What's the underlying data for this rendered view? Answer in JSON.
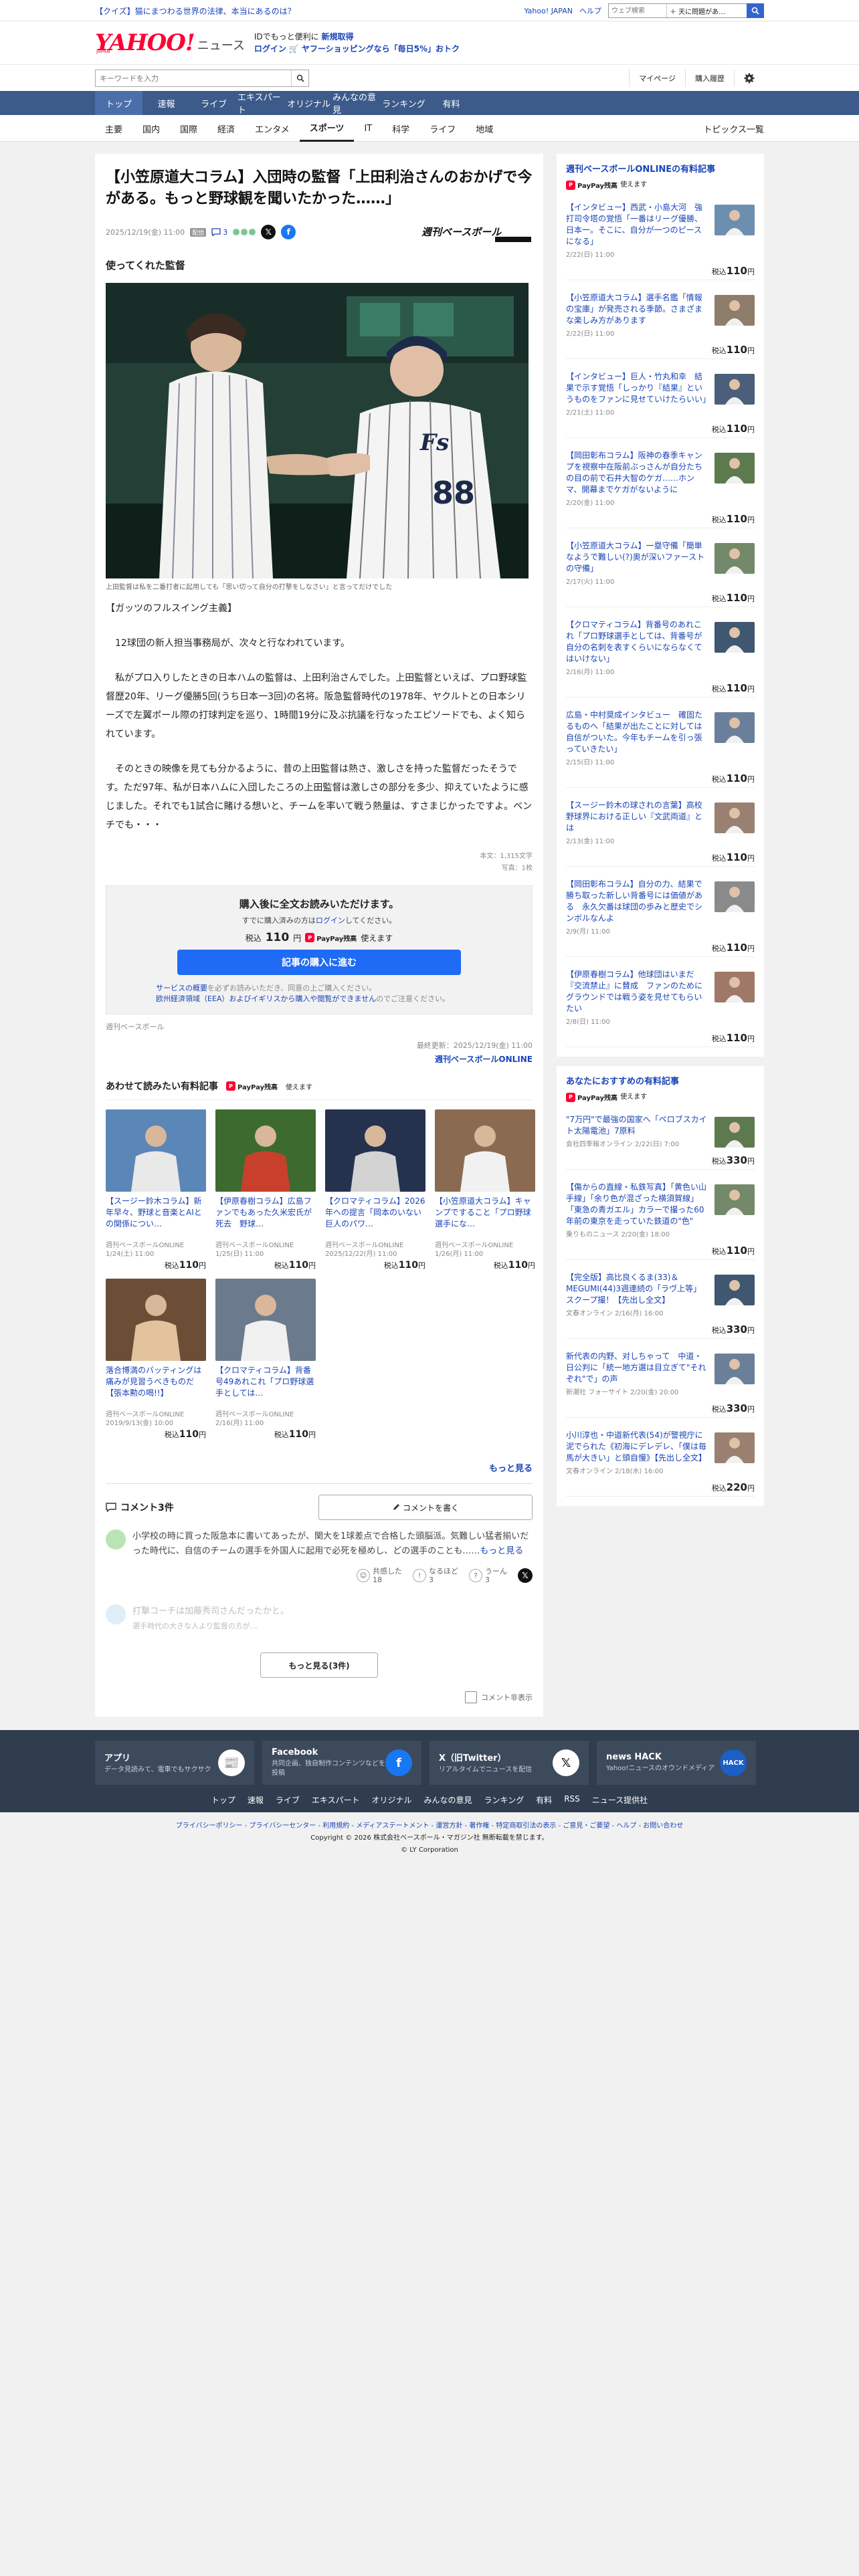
{
  "topbar": {
    "quiz": "【クイズ】猫にまつわる世界の法律、本当にあるのは？",
    "links": [
      "Yahoo! JAPAN",
      "ヘルプ"
    ],
    "search_placeholder": "ウェブ検索",
    "search_scope": "＋ 天に問題があ…"
  },
  "header": {
    "logo": "YAHOO!",
    "logo_sub": "JAPAN",
    "logo_news": "ニュース",
    "promo_line1_a": "IDでもっと便利に",
    "promo_line1_b": "新規取得",
    "promo_login": "ログイン",
    "promo_line2": "🛒 ヤフーショッピングなら「毎日5%」おトク"
  },
  "search": {
    "placeholder": "キーワードを入力",
    "mypage": "マイページ",
    "history": "購入履歴"
  },
  "gnav": [
    "トップ",
    "速報",
    "ライブ",
    "エキスパート",
    "オリジナル",
    "みんなの意見",
    "ランキング",
    "有料"
  ],
  "snav": [
    "主要",
    "国内",
    "国際",
    "経済",
    "エンタメ",
    "スポーツ",
    "IT",
    "科学",
    "ライフ",
    "地域"
  ],
  "snav_right": "トピックス一覧",
  "article": {
    "title": "【小笠原道大コラム】入団時の監督「上田利治さんのおかげで今がある。もっと野球観を聞いたかった……」",
    "date": "2025/12/19(金) 11:00",
    "badge": "配信",
    "comment_count": "3",
    "publisher_logo": "週刊ベースボール",
    "section": "使ってくれた監督",
    "caption": "上田監督は私を二番打者に起用しても「思い切って自分の打撃をしなさい」と言ってだけでした",
    "p1": "【ガッツのフルスイング主義】",
    "p2": "　12球団の新人担当事務局が、次々と行なわれています。",
    "p3": "　私がプロ入りしたときの日本ハムの監督は、上田利治さんでした。上田監督といえば、プロ野球監督歴20年、リーグ優勝5回(うち日本一3回)の名将。阪急監督時代の1978年、ヤクルトとの日本シリーズで左翼ポール際の打球判定を巡り、1時間19分に及ぶ抗議を行なったエピソードでも、よく知られています。",
    "p4": "　そのときの映像を見ても分かるように、昔の上田監督は熱さ、激しさを持った監督だったそうです。ただ97年、私が日本ハムに入団したころの上田監督は激しさの部分を多少、抑えていたように感じました。それでも1試合に賭ける想いと、チームを率いて戦う熱量は、すさまじかったですよ。ベンチでも・・・",
    "count1": "本文：1,315文字",
    "count2": "写真：1枚",
    "pay_heading": "購入後に全文お読みいただけます。",
    "pay_sub_a": "すでに購入済みの方は",
    "pay_sub_link": "ログイン",
    "pay_sub_b": "してください。",
    "price_label": "税込",
    "price": "110",
    "price_unit": "円",
    "paypay": "PayPay残高",
    "paypay_suffix": "使えます",
    "buy": "記事の購入に進む",
    "note1_link": "サービスの概要",
    "note1": "を必ずお読みいただき、同意の上ご購入ください。",
    "note2_link": "欧州経済領域（EEA）およびイギリスから購入や閲覧ができません",
    "note2": "のでご注意ください。",
    "publisher": "週刊ベースボール",
    "updated": "最終更新：2025/12/19(金) 11:00",
    "publisher_online": "週刊ベースボールONLINE"
  },
  "related": {
    "heading": "あわせて読みたい有料記事",
    "items": [
      {
        "title": "【スージー鈴木コラム】新年早々、野球と音楽とAIとの関係につい…",
        "source": "週刊ベースボールONLINE",
        "date": "1/24(土) 11:00",
        "price": "110"
      },
      {
        "title": "【伊原春樹コラム】広島ファンでもあった久米宏氏が死去　野球…",
        "source": "週刊ベースボールONLINE",
        "date": "1/25(日) 11:00",
        "price": "110"
      },
      {
        "title": "【クロマティコラム】2026年への提言「岡本のいない巨人のパワ…",
        "source": "週刊ベースボールONLINE",
        "date": "2025/12/22(月) 11:00",
        "price": "110"
      },
      {
        "title": "【小笠原道大コラム】キャンプですること「プロ野球選手にな…",
        "source": "週刊ベースボールONLINE",
        "date": "1/26(月) 11:00",
        "price": "110"
      },
      {
        "title": "落合博満のバッティングは痛みが見習うべきものだ【張本勲の喝!!】",
        "source": "週刊ベースボールONLINE",
        "date": "2019/9/13(金) 10:00",
        "price": "110"
      },
      {
        "title": "【クロマティコラム】背番号49あれこれ「プロ野球選手としては…",
        "source": "週刊ベースボールONLINE",
        "date": "2/16(月) 11:00",
        "price": "110"
      }
    ],
    "more": "もっと見る"
  },
  "comments": {
    "heading": "コメント3件",
    "write": "コメントを書く",
    "first": "小学校の時に買った阪急本に書いてあったが、関大を1球差点で合格した頭脳派。気難しい猛者揃いだった時代に、自信のチームの選手を外国人に起用で必死を極めし、どの選手のことも……",
    "first_more": "もっと見る",
    "r1_label": "共感した",
    "r1": "18",
    "r2_label": "なるほど",
    "r2": "3",
    "r3_label": "うーん",
    "r3": "3",
    "second": "打撃コーチは加藤秀司さんだったかと。",
    "second_b": "選手時代の大きな人より監督の方が…",
    "more": "もっと見る(3件)",
    "hide": "コメント非表示"
  },
  "sidebar": {
    "heading1": "週刊ベースボールONLINEの有料記事",
    "items1": [
      {
        "title": "【インタビュー】西武・小島大河　強打司令塔の覚悟「一番はリーグ優勝、日本一。そこに、自分が一つのピースになる」",
        "date": "2/22(日) 11:00",
        "price": "110"
      },
      {
        "title": "【小笠原道大コラム】選手名鑑「情報の宝庫」が発売される季節。さまざまな楽しみ方があります",
        "date": "2/22(日) 11:00",
        "price": "110"
      },
      {
        "title": "【インタビュー】巨人・竹丸和幸　結果で示す覚悟「しっかり『結果』というものをファンに見せていけたらいい」",
        "date": "2/21(土) 11:00",
        "price": "110"
      },
      {
        "title": "【岡田彰布コラム】阪神の春季キャンプを視察中在阪前ぶっさんが自分たちの目の前で石井大智のケガ……ホンマ、開幕までケガがないように",
        "date": "2/20(金) 11:00",
        "price": "110"
      },
      {
        "title": "【小笠原道大コラム】一塁守備「簡単なようで難しい(?)奥が深いファーストの守備」",
        "date": "2/17(火) 11:00",
        "price": "110"
      },
      {
        "title": "【クロマティコラム】背番号のあれこれ「プロ野球選手としては、背番号が自分の名刺を表すくらいにならなくてはいけない」",
        "date": "2/16(月) 11:00",
        "price": "110"
      },
      {
        "title": "広島・中村奨成インタビュー　確固たるものへ「結果が出たことに対しては自信がついた。今年もチームを引っ張っていきたい」",
        "date": "2/15(日) 11:00",
        "price": "110"
      },
      {
        "title": "【スージー鈴木の球されの言葉】高校野球界における正しい『文武両道』とは",
        "date": "2/13(金) 11:00",
        "price": "110"
      },
      {
        "title": "【岡田彰布コラム】自分の力、結果で勝ち取った新しい背番号には価値がある　永久欠番は球団の歩みと歴史でシンボルなんよ",
        "date": "2/9(月) 11:00",
        "price": "110"
      },
      {
        "title": "【伊原春樹コラム】他球団はいまだ『交流禁止』に賛成　ファンのためにグラウンドでは戦う姿を見せてもらいたい",
        "date": "2/8(日) 11:00",
        "price": "110"
      }
    ],
    "heading2": "あなたにおすすめの有料記事",
    "items2": [
      {
        "title": "\"7万円\"で最強の国家へ「ペロブスカイト太陽電池」7原料",
        "date": "会社四季報オンライン 2/22(日) 7:00",
        "price": "330"
      },
      {
        "title": "【傷からの直線・私鉄写真】「黄色い山手線」「余り色が混ざった横須賀線」「東急の青ガエル」カラーで撮った60年前の東京を走っていた鉄道の\"色\"",
        "date": "乗りものニュース 2/20(金) 18:00",
        "price": "110"
      },
      {
        "title": "【完全版】高比良くるま(33)＆MEGUMI(44)3週連続の「ラヴ上等」スクープ撮！【先出し全文】",
        "date": "文春オンライン 2/16(月) 16:00",
        "price": "330"
      },
      {
        "title": "新代表の内野、对しちゃって　中道・日公判に「統一地方選は目立ぎて\"それぞれ\"で」の声",
        "date": "新潮社 フォーサイト 2/20(金) 20:00",
        "price": "330"
      },
      {
        "title": "小川淳也・中道新代表(54)が警視庁に泥でられた《初海にデレデレ、「僕は毎馬が大きい」と頭自慢》【先出し全文】",
        "date": "文春オンライン 2/18(水) 16:00",
        "price": "220"
      }
    ]
  },
  "footer": {
    "apps": [
      {
        "name": "アプリ",
        "desc": "データ見読みて、電車でもサクサク",
        "icon": "📰"
      },
      {
        "name": "Facebook",
        "desc": "共同企画、独自制作コンテンツなどを投稿",
        "icon": "f"
      },
      {
        "name": "X（旧Twitter）",
        "desc": "リアルタイムでニュースを配信",
        "icon": "𝕏"
      },
      {
        "name": "news HACK",
        "desc": "Yahoo!ニュースのオウンドメディア",
        "icon": "HACK"
      }
    ],
    "nav": [
      "トップ",
      "速報",
      "ライブ",
      "エキスパート",
      "オリジナル",
      "みんなの意見",
      "ランキング",
      "有料",
      "RSS",
      "ニュース提供社"
    ],
    "legal": "プライバシーポリシー - プライバシーセンター - 利用規約 - メディアステートメント - 運営方針 - 著作権 - 特定商取引法の表示 - ご意見・ご要望 - ヘルプ - お問い合わせ",
    "copyright1": "Copyright © 2026 株式会社ベースボール・マガジン社 無断転載を禁じます。",
    "copyright2": "© LY Corporation"
  },
  "colors": {
    "brand": "#ff0033",
    "nav": "#3c5a8a",
    "link": "#1a44b8",
    "buy": "#1f6bf5"
  }
}
